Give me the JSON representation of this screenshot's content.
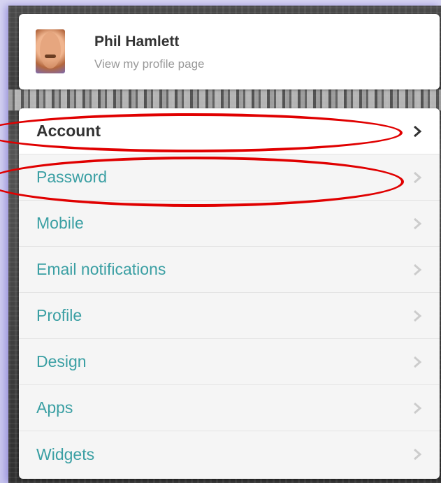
{
  "profile": {
    "name": "Phil Hamlett",
    "subtitle": "View my profile page"
  },
  "menu": {
    "items": [
      {
        "label": "Account",
        "active": true
      },
      {
        "label": "Password",
        "active": false
      },
      {
        "label": "Mobile",
        "active": false
      },
      {
        "label": "Email notifications",
        "active": false
      },
      {
        "label": "Profile",
        "active": false
      },
      {
        "label": "Design",
        "active": false
      },
      {
        "label": "Apps",
        "active": false
      },
      {
        "label": "Widgets",
        "active": false
      }
    ]
  },
  "colors": {
    "link": "#3a9fa3",
    "active_text": "#333333",
    "annotation": "#e00000",
    "frame_glow": "#c9c6ee"
  },
  "icons": {
    "chevron": "chevron-right-icon"
  }
}
